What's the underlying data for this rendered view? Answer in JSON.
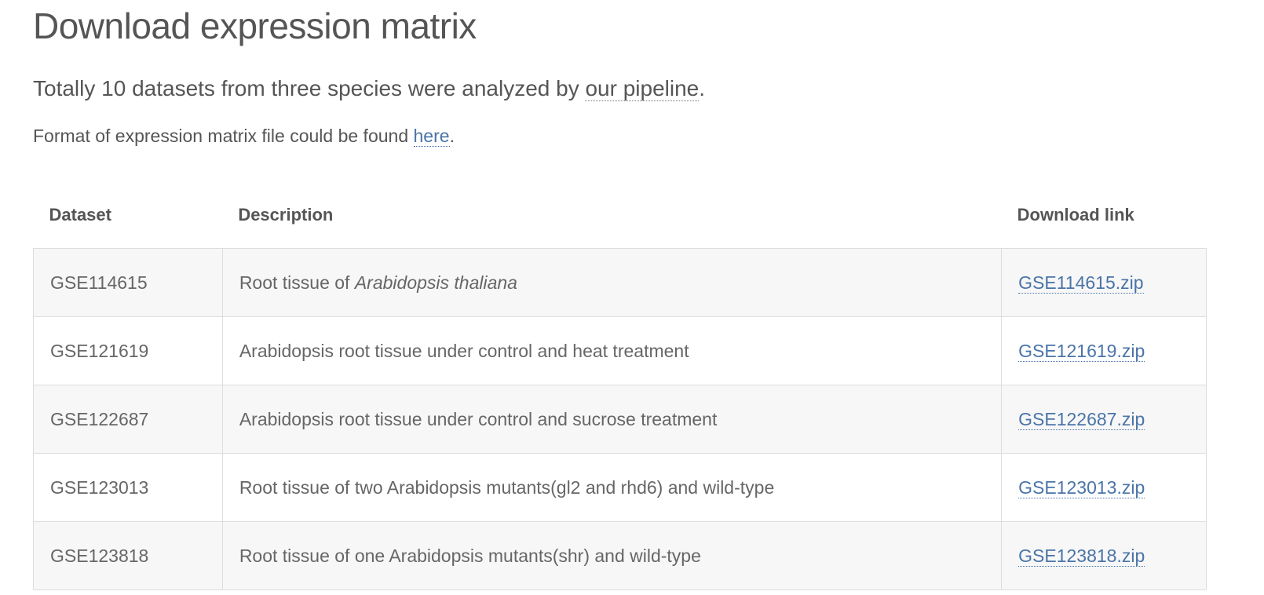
{
  "page": {
    "title": "Download expression matrix",
    "intro_prefix": "Totally 10 datasets from three species were analyzed by ",
    "intro_link": "our pipeline",
    "intro_suffix": ".",
    "format_prefix": "Format of expression matrix file could be found ",
    "format_link": "here",
    "format_suffix": "."
  },
  "table": {
    "headers": [
      "Dataset",
      "Description",
      "Download link"
    ],
    "rows": [
      {
        "dataset": "GSE114615",
        "desc_prefix": "Root tissue of ",
        "desc_italic": "Arabidopsis thaliana",
        "link": "GSE114615.zip"
      },
      {
        "dataset": "GSE121619",
        "desc_prefix": "Arabidopsis root tissue under control and heat treatment",
        "desc_italic": "",
        "link": "GSE121619.zip"
      },
      {
        "dataset": "GSE122687",
        "desc_prefix": "Arabidopsis root tissue under control and sucrose treatment",
        "desc_italic": "",
        "link": "GSE122687.zip"
      },
      {
        "dataset": "GSE123013",
        "desc_prefix": "Root tissue of two Arabidopsis mutants(gl2 and rhd6) and wild-type",
        "desc_italic": "",
        "link": "GSE123013.zip"
      },
      {
        "dataset": "GSE123818",
        "desc_prefix": "Root tissue of one Arabidopsis mutants(shr) and wild-type",
        "desc_italic": "",
        "link": "GSE123818.zip"
      }
    ]
  },
  "colors": {
    "text": "#555555",
    "link": "#4a74a8",
    "row_alt": "#f7f7f7",
    "border": "#dddddd"
  }
}
